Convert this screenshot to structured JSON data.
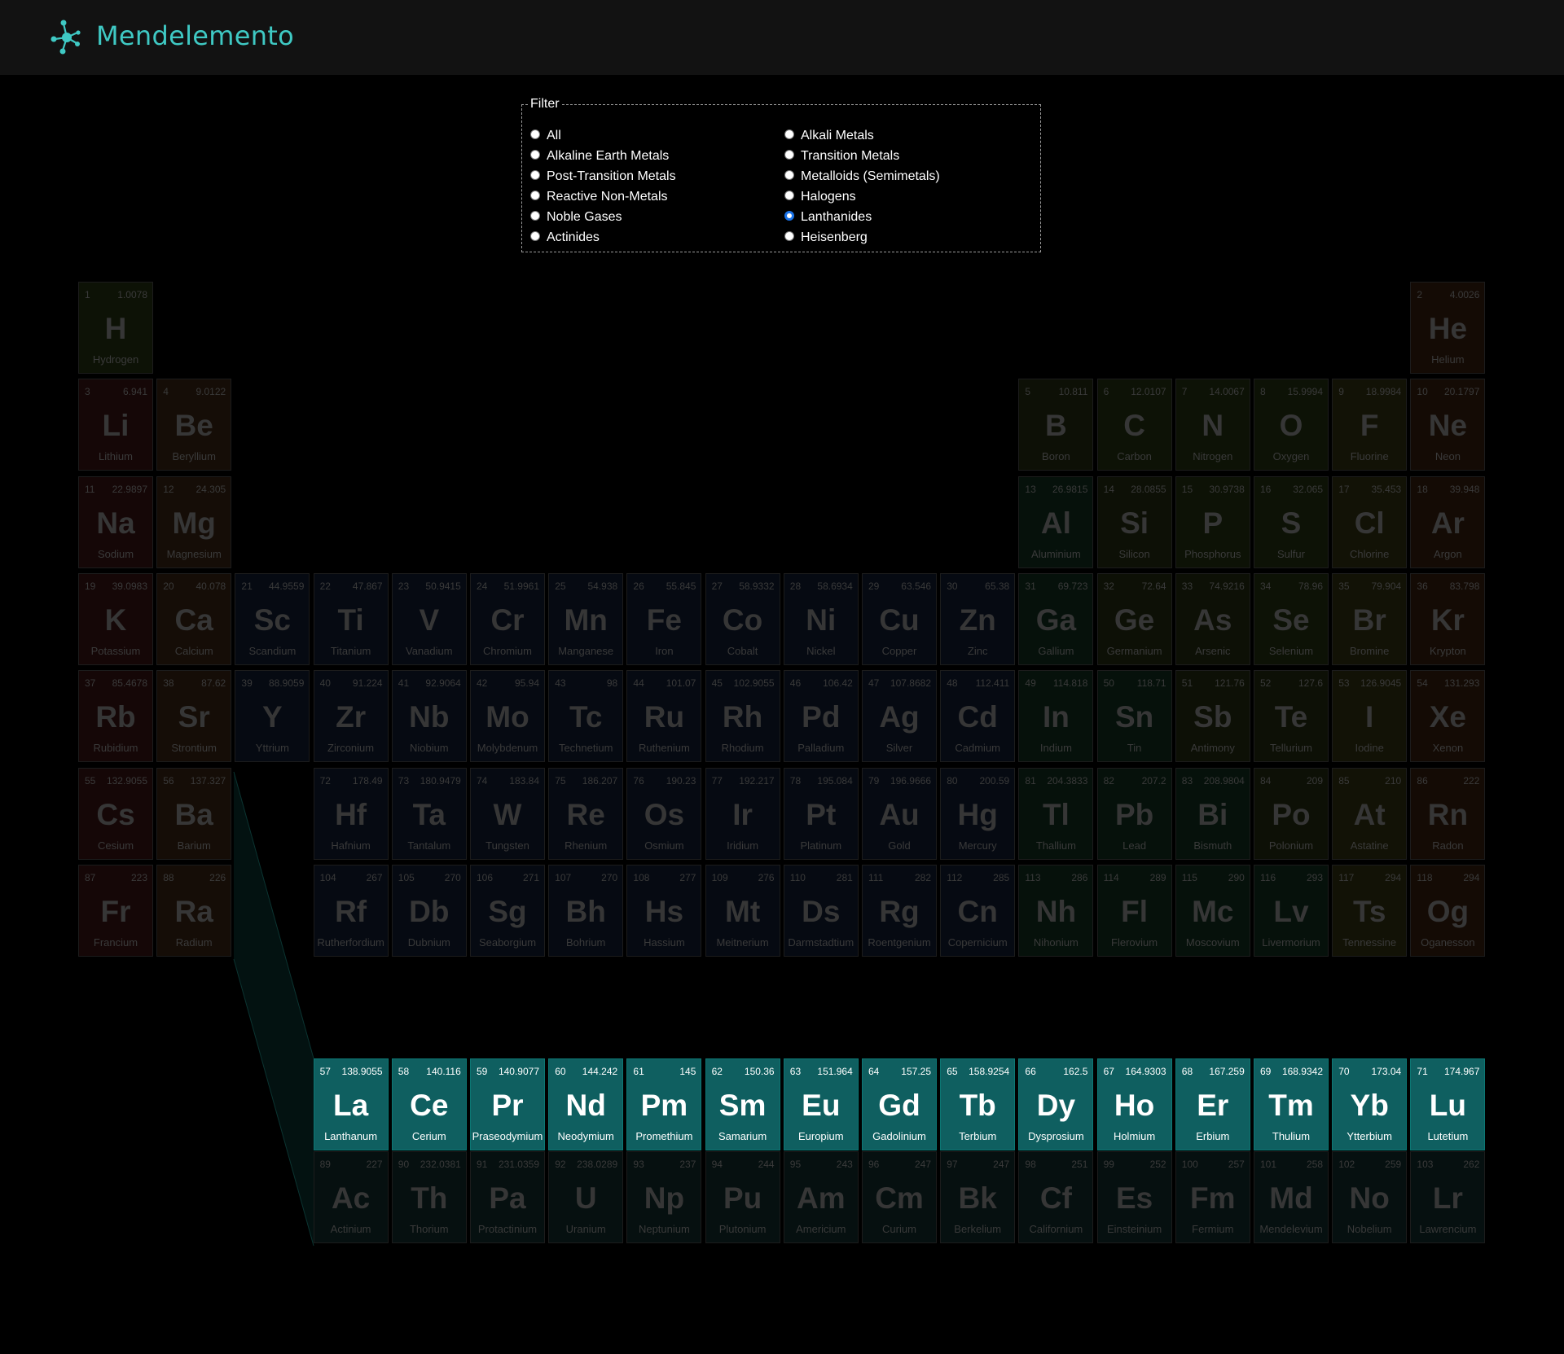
{
  "app": {
    "title": "Mendelemento"
  },
  "filter": {
    "legend": "Filter",
    "selected": "Lanthanides",
    "options": [
      "All",
      "Alkali Metals",
      "Alkaline Earth Metals",
      "Transition Metals",
      "Post-Transition Metals",
      "Metalloids (Semimetals)",
      "Reactive Non-Metals",
      "Halogens",
      "Noble Gases",
      "Lanthanides",
      "Actinides",
      "Heisenberg"
    ]
  },
  "colors": {
    "accent": "#3fc9c4",
    "active_cell": "#0f5f60",
    "alkali": "#150707",
    "alkaline": "#150d07",
    "transition": "#060a12",
    "post_transition": "#06110b",
    "metalloid": "#0d1006",
    "nonmetal": "#0d1206",
    "halogen": "#121206",
    "noble": "#140b05",
    "lanthanide": "#0f5f60",
    "actinide": "#061010"
  },
  "elements": [
    {
      "n": "1",
      "m": "1.0078",
      "s": "H",
      "name": "Hydrogen",
      "c": "nonmetal",
      "r": 0,
      "col": 0
    },
    {
      "n": "2",
      "m": "4.0026",
      "s": "He",
      "name": "Helium",
      "c": "noble",
      "r": 0,
      "col": 17
    },
    {
      "n": "3",
      "m": "6.941",
      "s": "Li",
      "name": "Lithium",
      "c": "alkali",
      "r": 1,
      "col": 0
    },
    {
      "n": "4",
      "m": "9.0122",
      "s": "Be",
      "name": "Beryllium",
      "c": "alkaline",
      "r": 1,
      "col": 1
    },
    {
      "n": "5",
      "m": "10.811",
      "s": "B",
      "name": "Boron",
      "c": "metalloid",
      "r": 1,
      "col": 12
    },
    {
      "n": "6",
      "m": "12.0107",
      "s": "C",
      "name": "Carbon",
      "c": "nonmetal",
      "r": 1,
      "col": 13
    },
    {
      "n": "7",
      "m": "14.0067",
      "s": "N",
      "name": "Nitrogen",
      "c": "nonmetal",
      "r": 1,
      "col": 14
    },
    {
      "n": "8",
      "m": "15.9994",
      "s": "O",
      "name": "Oxygen",
      "c": "nonmetal",
      "r": 1,
      "col": 15
    },
    {
      "n": "9",
      "m": "18.9984",
      "s": "F",
      "name": "Fluorine",
      "c": "halogen",
      "r": 1,
      "col": 16
    },
    {
      "n": "10",
      "m": "20.1797",
      "s": "Ne",
      "name": "Neon",
      "c": "noble",
      "r": 1,
      "col": 17
    },
    {
      "n": "11",
      "m": "22.9897",
      "s": "Na",
      "name": "Sodium",
      "c": "alkali",
      "r": 2,
      "col": 0
    },
    {
      "n": "12",
      "m": "24.305",
      "s": "Mg",
      "name": "Magnesium",
      "c": "alkaline",
      "r": 2,
      "col": 1
    },
    {
      "n": "13",
      "m": "26.9815",
      "s": "Al",
      "name": "Aluminium",
      "c": "post_transition",
      "r": 2,
      "col": 12
    },
    {
      "n": "14",
      "m": "28.0855",
      "s": "Si",
      "name": "Silicon",
      "c": "metalloid",
      "r": 2,
      "col": 13
    },
    {
      "n": "15",
      "m": "30.9738",
      "s": "P",
      "name": "Phosphorus",
      "c": "nonmetal",
      "r": 2,
      "col": 14
    },
    {
      "n": "16",
      "m": "32.065",
      "s": "S",
      "name": "Sulfur",
      "c": "nonmetal",
      "r": 2,
      "col": 15
    },
    {
      "n": "17",
      "m": "35.453",
      "s": "Cl",
      "name": "Chlorine",
      "c": "halogen",
      "r": 2,
      "col": 16
    },
    {
      "n": "18",
      "m": "39.948",
      "s": "Ar",
      "name": "Argon",
      "c": "noble",
      "r": 2,
      "col": 17
    },
    {
      "n": "19",
      "m": "39.0983",
      "s": "K",
      "name": "Potassium",
      "c": "alkali",
      "r": 3,
      "col": 0
    },
    {
      "n": "20",
      "m": "40.078",
      "s": "Ca",
      "name": "Calcium",
      "c": "alkaline",
      "r": 3,
      "col": 1
    },
    {
      "n": "21",
      "m": "44.9559",
      "s": "Sc",
      "name": "Scandium",
      "c": "transition",
      "r": 3,
      "col": 2
    },
    {
      "n": "22",
      "m": "47.867",
      "s": "Ti",
      "name": "Titanium",
      "c": "transition",
      "r": 3,
      "col": 3
    },
    {
      "n": "23",
      "m": "50.9415",
      "s": "V",
      "name": "Vanadium",
      "c": "transition",
      "r": 3,
      "col": 4
    },
    {
      "n": "24",
      "m": "51.9961",
      "s": "Cr",
      "name": "Chromium",
      "c": "transition",
      "r": 3,
      "col": 5
    },
    {
      "n": "25",
      "m": "54.938",
      "s": "Mn",
      "name": "Manganese",
      "c": "transition",
      "r": 3,
      "col": 6
    },
    {
      "n": "26",
      "m": "55.845",
      "s": "Fe",
      "name": "Iron",
      "c": "transition",
      "r": 3,
      "col": 7
    },
    {
      "n": "27",
      "m": "58.9332",
      "s": "Co",
      "name": "Cobalt",
      "c": "transition",
      "r": 3,
      "col": 8
    },
    {
      "n": "28",
      "m": "58.6934",
      "s": "Ni",
      "name": "Nickel",
      "c": "transition",
      "r": 3,
      "col": 9
    },
    {
      "n": "29",
      "m": "63.546",
      "s": "Cu",
      "name": "Copper",
      "c": "transition",
      "r": 3,
      "col": 10
    },
    {
      "n": "30",
      "m": "65.38",
      "s": "Zn",
      "name": "Zinc",
      "c": "transition",
      "r": 3,
      "col": 11
    },
    {
      "n": "31",
      "m": "69.723",
      "s": "Ga",
      "name": "Gallium",
      "c": "post_transition",
      "r": 3,
      "col": 12
    },
    {
      "n": "32",
      "m": "72.64",
      "s": "Ge",
      "name": "Germanium",
      "c": "metalloid",
      "r": 3,
      "col": 13
    },
    {
      "n": "33",
      "m": "74.9216",
      "s": "As",
      "name": "Arsenic",
      "c": "metalloid",
      "r": 3,
      "col": 14
    },
    {
      "n": "34",
      "m": "78.96",
      "s": "Se",
      "name": "Selenium",
      "c": "nonmetal",
      "r": 3,
      "col": 15
    },
    {
      "n": "35",
      "m": "79.904",
      "s": "Br",
      "name": "Bromine",
      "c": "halogen",
      "r": 3,
      "col": 16
    },
    {
      "n": "36",
      "m": "83.798",
      "s": "Kr",
      "name": "Krypton",
      "c": "noble",
      "r": 3,
      "col": 17
    },
    {
      "n": "37",
      "m": "85.4678",
      "s": "Rb",
      "name": "Rubidium",
      "c": "alkali",
      "r": 4,
      "col": 0
    },
    {
      "n": "38",
      "m": "87.62",
      "s": "Sr",
      "name": "Strontium",
      "c": "alkaline",
      "r": 4,
      "col": 1
    },
    {
      "n": "39",
      "m": "88.9059",
      "s": "Y",
      "name": "Yttrium",
      "c": "transition",
      "r": 4,
      "col": 2
    },
    {
      "n": "40",
      "m": "91.224",
      "s": "Zr",
      "name": "Zirconium",
      "c": "transition",
      "r": 4,
      "col": 3
    },
    {
      "n": "41",
      "m": "92.9064",
      "s": "Nb",
      "name": "Niobium",
      "c": "transition",
      "r": 4,
      "col": 4
    },
    {
      "n": "42",
      "m": "95.94",
      "s": "Mo",
      "name": "Molybdenum",
      "c": "transition",
      "r": 4,
      "col": 5
    },
    {
      "n": "43",
      "m": "98",
      "s": "Tc",
      "name": "Technetium",
      "c": "transition",
      "r": 4,
      "col": 6
    },
    {
      "n": "44",
      "m": "101.07",
      "s": "Ru",
      "name": "Ruthenium",
      "c": "transition",
      "r": 4,
      "col": 7
    },
    {
      "n": "45",
      "m": "102.9055",
      "s": "Rh",
      "name": "Rhodium",
      "c": "transition",
      "r": 4,
      "col": 8
    },
    {
      "n": "46",
      "m": "106.42",
      "s": "Pd",
      "name": "Palladium",
      "c": "transition",
      "r": 4,
      "col": 9
    },
    {
      "n": "47",
      "m": "107.8682",
      "s": "Ag",
      "name": "Silver",
      "c": "transition",
      "r": 4,
      "col": 10
    },
    {
      "n": "48",
      "m": "112.411",
      "s": "Cd",
      "name": "Cadmium",
      "c": "transition",
      "r": 4,
      "col": 11
    },
    {
      "n": "49",
      "m": "114.818",
      "s": "In",
      "name": "Indium",
      "c": "post_transition",
      "r": 4,
      "col": 12
    },
    {
      "n": "50",
      "m": "118.71",
      "s": "Sn",
      "name": "Tin",
      "c": "post_transition",
      "r": 4,
      "col": 13
    },
    {
      "n": "51",
      "m": "121.76",
      "s": "Sb",
      "name": "Antimony",
      "c": "metalloid",
      "r": 4,
      "col": 14
    },
    {
      "n": "52",
      "m": "127.6",
      "s": "Te",
      "name": "Tellurium",
      "c": "metalloid",
      "r": 4,
      "col": 15
    },
    {
      "n": "53",
      "m": "126.9045",
      "s": "I",
      "name": "Iodine",
      "c": "halogen",
      "r": 4,
      "col": 16
    },
    {
      "n": "54",
      "m": "131.293",
      "s": "Xe",
      "name": "Xenon",
      "c": "noble",
      "r": 4,
      "col": 17
    },
    {
      "n": "55",
      "m": "132.9055",
      "s": "Cs",
      "name": "Cesium",
      "c": "alkali",
      "r": 5,
      "col": 0
    },
    {
      "n": "56",
      "m": "137.327",
      "s": "Ba",
      "name": "Barium",
      "c": "alkaline",
      "r": 5,
      "col": 1
    },
    {
      "n": "72",
      "m": "178.49",
      "s": "Hf",
      "name": "Hafnium",
      "c": "transition",
      "r": 5,
      "col": 3
    },
    {
      "n": "73",
      "m": "180.9479",
      "s": "Ta",
      "name": "Tantalum",
      "c": "transition",
      "r": 5,
      "col": 4
    },
    {
      "n": "74",
      "m": "183.84",
      "s": "W",
      "name": "Tungsten",
      "c": "transition",
      "r": 5,
      "col": 5
    },
    {
      "n": "75",
      "m": "186.207",
      "s": "Re",
      "name": "Rhenium",
      "c": "transition",
      "r": 5,
      "col": 6
    },
    {
      "n": "76",
      "m": "190.23",
      "s": "Os",
      "name": "Osmium",
      "c": "transition",
      "r": 5,
      "col": 7
    },
    {
      "n": "77",
      "m": "192.217",
      "s": "Ir",
      "name": "Iridium",
      "c": "transition",
      "r": 5,
      "col": 8
    },
    {
      "n": "78",
      "m": "195.084",
      "s": "Pt",
      "name": "Platinum",
      "c": "transition",
      "r": 5,
      "col": 9
    },
    {
      "n": "79",
      "m": "196.9666",
      "s": "Au",
      "name": "Gold",
      "c": "transition",
      "r": 5,
      "col": 10
    },
    {
      "n": "80",
      "m": "200.59",
      "s": "Hg",
      "name": "Mercury",
      "c": "transition",
      "r": 5,
      "col": 11
    },
    {
      "n": "81",
      "m": "204.3833",
      "s": "Tl",
      "name": "Thallium",
      "c": "post_transition",
      "r": 5,
      "col": 12
    },
    {
      "n": "82",
      "m": "207.2",
      "s": "Pb",
      "name": "Lead",
      "c": "post_transition",
      "r": 5,
      "col": 13
    },
    {
      "n": "83",
      "m": "208.9804",
      "s": "Bi",
      "name": "Bismuth",
      "c": "post_transition",
      "r": 5,
      "col": 14
    },
    {
      "n": "84",
      "m": "209",
      "s": "Po",
      "name": "Polonium",
      "c": "metalloid",
      "r": 5,
      "col": 15
    },
    {
      "n": "85",
      "m": "210",
      "s": "At",
      "name": "Astatine",
      "c": "halogen",
      "r": 5,
      "col": 16
    },
    {
      "n": "86",
      "m": "222",
      "s": "Rn",
      "name": "Radon",
      "c": "noble",
      "r": 5,
      "col": 17
    },
    {
      "n": "87",
      "m": "223",
      "s": "Fr",
      "name": "Francium",
      "c": "alkali",
      "r": 6,
      "col": 0
    },
    {
      "n": "88",
      "m": "226",
      "s": "Ra",
      "name": "Radium",
      "c": "alkaline",
      "r": 6,
      "col": 1
    },
    {
      "n": "104",
      "m": "267",
      "s": "Rf",
      "name": "Rutherfordium",
      "c": "transition",
      "r": 6,
      "col": 3
    },
    {
      "n": "105",
      "m": "270",
      "s": "Db",
      "name": "Dubnium",
      "c": "transition",
      "r": 6,
      "col": 4
    },
    {
      "n": "106",
      "m": "271",
      "s": "Sg",
      "name": "Seaborgium",
      "c": "transition",
      "r": 6,
      "col": 5
    },
    {
      "n": "107",
      "m": "270",
      "s": "Bh",
      "name": "Bohrium",
      "c": "transition",
      "r": 6,
      "col": 6
    },
    {
      "n": "108",
      "m": "277",
      "s": "Hs",
      "name": "Hassium",
      "c": "transition",
      "r": 6,
      "col": 7
    },
    {
      "n": "109",
      "m": "276",
      "s": "Mt",
      "name": "Meitnerium",
      "c": "transition",
      "r": 6,
      "col": 8
    },
    {
      "n": "110",
      "m": "281",
      "s": "Ds",
      "name": "Darmstadtium",
      "c": "transition",
      "r": 6,
      "col": 9
    },
    {
      "n": "111",
      "m": "282",
      "s": "Rg",
      "name": "Roentgenium",
      "c": "transition",
      "r": 6,
      "col": 10
    },
    {
      "n": "112",
      "m": "285",
      "s": "Cn",
      "name": "Copernicium",
      "c": "transition",
      "r": 6,
      "col": 11
    },
    {
      "n": "113",
      "m": "286",
      "s": "Nh",
      "name": "Nihonium",
      "c": "post_transition",
      "r": 6,
      "col": 12
    },
    {
      "n": "114",
      "m": "289",
      "s": "Fl",
      "name": "Flerovium",
      "c": "post_transition",
      "r": 6,
      "col": 13
    },
    {
      "n": "115",
      "m": "290",
      "s": "Mc",
      "name": "Moscovium",
      "c": "post_transition",
      "r": 6,
      "col": 14
    },
    {
      "n": "116",
      "m": "293",
      "s": "Lv",
      "name": "Livermorium",
      "c": "post_transition",
      "r": 6,
      "col": 15
    },
    {
      "n": "117",
      "m": "294",
      "s": "Ts",
      "name": "Tennessine",
      "c": "halogen",
      "r": 6,
      "col": 16
    },
    {
      "n": "118",
      "m": "294",
      "s": "Og",
      "name": "Oganesson",
      "c": "noble",
      "r": 6,
      "col": 17
    },
    {
      "n": "57",
      "m": "138.9055",
      "s": "La",
      "name": "Lanthanum",
      "c": "lanthanide",
      "r": 8,
      "col": 3
    },
    {
      "n": "58",
      "m": "140.116",
      "s": "Ce",
      "name": "Cerium",
      "c": "lanthanide",
      "r": 8,
      "col": 4
    },
    {
      "n": "59",
      "m": "140.9077",
      "s": "Pr",
      "name": "Praseodymium",
      "c": "lanthanide",
      "r": 8,
      "col": 5
    },
    {
      "n": "60",
      "m": "144.242",
      "s": "Nd",
      "name": "Neodymium",
      "c": "lanthanide",
      "r": 8,
      "col": 6
    },
    {
      "n": "61",
      "m": "145",
      "s": "Pm",
      "name": "Promethium",
      "c": "lanthanide",
      "r": 8,
      "col": 7
    },
    {
      "n": "62",
      "m": "150.36",
      "s": "Sm",
      "name": "Samarium",
      "c": "lanthanide",
      "r": 8,
      "col": 8
    },
    {
      "n": "63",
      "m": "151.964",
      "s": "Eu",
      "name": "Europium",
      "c": "lanthanide",
      "r": 8,
      "col": 9
    },
    {
      "n": "64",
      "m": "157.25",
      "s": "Gd",
      "name": "Gadolinium",
      "c": "lanthanide",
      "r": 8,
      "col": 10
    },
    {
      "n": "65",
      "m": "158.9254",
      "s": "Tb",
      "name": "Terbium",
      "c": "lanthanide",
      "r": 8,
      "col": 11
    },
    {
      "n": "66",
      "m": "162.5",
      "s": "Dy",
      "name": "Dysprosium",
      "c": "lanthanide",
      "r": 8,
      "col": 12
    },
    {
      "n": "67",
      "m": "164.9303",
      "s": "Ho",
      "name": "Holmium",
      "c": "lanthanide",
      "r": 8,
      "col": 13
    },
    {
      "n": "68",
      "m": "167.259",
      "s": "Er",
      "name": "Erbium",
      "c": "lanthanide",
      "r": 8,
      "col": 14
    },
    {
      "n": "69",
      "m": "168.9342",
      "s": "Tm",
      "name": "Thulium",
      "c": "lanthanide",
      "r": 8,
      "col": 15
    },
    {
      "n": "70",
      "m": "173.04",
      "s": "Yb",
      "name": "Ytterbium",
      "c": "lanthanide",
      "r": 8,
      "col": 16
    },
    {
      "n": "71",
      "m": "174.967",
      "s": "Lu",
      "name": "Lutetium",
      "c": "lanthanide",
      "r": 8,
      "col": 17
    },
    {
      "n": "89",
      "m": "227",
      "s": "Ac",
      "name": "Actinium",
      "c": "actinide",
      "r": 9,
      "col": 3
    },
    {
      "n": "90",
      "m": "232.0381",
      "s": "Th",
      "name": "Thorium",
      "c": "actinide",
      "r": 9,
      "col": 4
    },
    {
      "n": "91",
      "m": "231.0359",
      "s": "Pa",
      "name": "Protactinium",
      "c": "actinide",
      "r": 9,
      "col": 5
    },
    {
      "n": "92",
      "m": "238.0289",
      "s": "U",
      "name": "Uranium",
      "c": "actinide",
      "r": 9,
      "col": 6
    },
    {
      "n": "93",
      "m": "237",
      "s": "Np",
      "name": "Neptunium",
      "c": "actinide",
      "r": 9,
      "col": 7
    },
    {
      "n": "94",
      "m": "244",
      "s": "Pu",
      "name": "Plutonium",
      "c": "actinide",
      "r": 9,
      "col": 8
    },
    {
      "n": "95",
      "m": "243",
      "s": "Am",
      "name": "Americium",
      "c": "actinide",
      "r": 9,
      "col": 9
    },
    {
      "n": "96",
      "m": "247",
      "s": "Cm",
      "name": "Curium",
      "c": "actinide",
      "r": 9,
      "col": 10
    },
    {
      "n": "97",
      "m": "247",
      "s": "Bk",
      "name": "Berkelium",
      "c": "actinide",
      "r": 9,
      "col": 11
    },
    {
      "n": "98",
      "m": "251",
      "s": "Cf",
      "name": "Californium",
      "c": "actinide",
      "r": 9,
      "col": 12
    },
    {
      "n": "99",
      "m": "252",
      "s": "Es",
      "name": "Einsteinium",
      "c": "actinide",
      "r": 9,
      "col": 13
    },
    {
      "n": "100",
      "m": "257",
      "s": "Fm",
      "name": "Fermium",
      "c": "actinide",
      "r": 9,
      "col": 14
    },
    {
      "n": "101",
      "m": "258",
      "s": "Md",
      "name": "Mendelevium",
      "c": "actinide",
      "r": 9,
      "col": 15
    },
    {
      "n": "102",
      "m": "259",
      "s": "No",
      "name": "Nobelium",
      "c": "actinide",
      "r": 9,
      "col": 16
    },
    {
      "n": "103",
      "m": "262",
      "s": "Lr",
      "name": "Lawrencium",
      "c": "actinide",
      "r": 9,
      "col": 17
    }
  ]
}
